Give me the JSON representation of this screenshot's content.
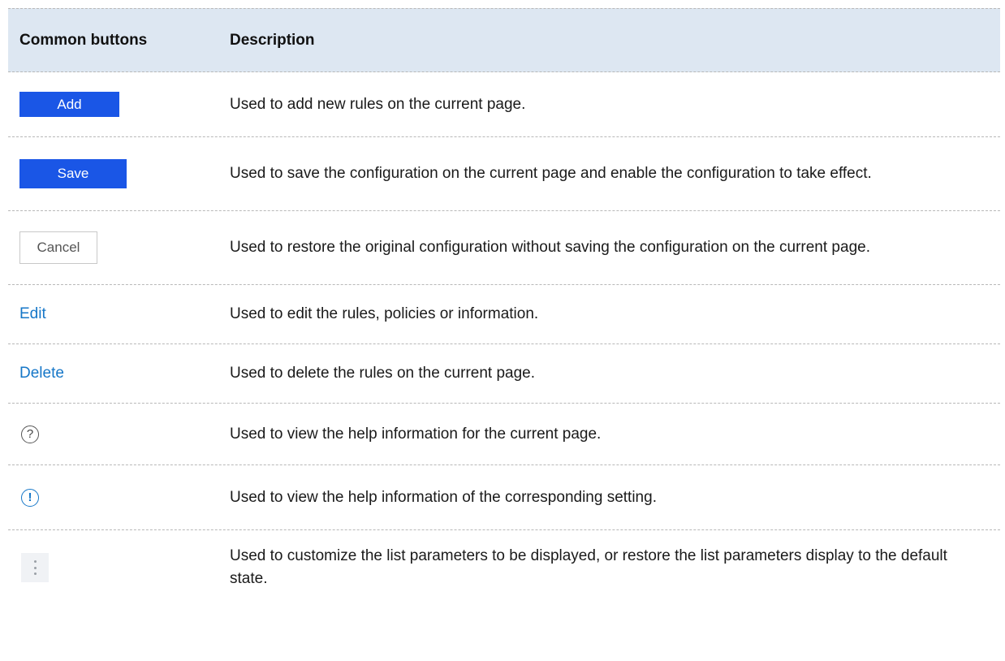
{
  "table": {
    "headers": {
      "buttons": "Common buttons",
      "description": "Description"
    },
    "rows": {
      "add": {
        "label": "Add",
        "description": "Used to add new rules on the current page."
      },
      "save": {
        "label": "Save",
        "description": "Used to save the configuration on the current page and enable the configuration to take effect."
      },
      "cancel": {
        "label": "Cancel",
        "description": "Used to restore the original configuration without saving the configuration on the current page."
      },
      "edit": {
        "label": "Edit",
        "description": "Used to edit the rules, policies or information."
      },
      "delete": {
        "label": "Delete",
        "description": "Used to delete the rules on the current page."
      },
      "help": {
        "icon": "help-circle-icon",
        "glyph": "?",
        "description": "Used to view the help information for the current page."
      },
      "info": {
        "icon": "info-circle-icon",
        "glyph": "!",
        "description": "Used to view the help information of the corresponding setting."
      },
      "more": {
        "icon": "more-vertical-icon",
        "description": "Used to customize the list parameters to be displayed, or restore the list parameters display to the default state."
      }
    }
  },
  "colors": {
    "primary": "#1a56e6",
    "link": "#1677c8",
    "header_bg": "#dde7f2"
  }
}
